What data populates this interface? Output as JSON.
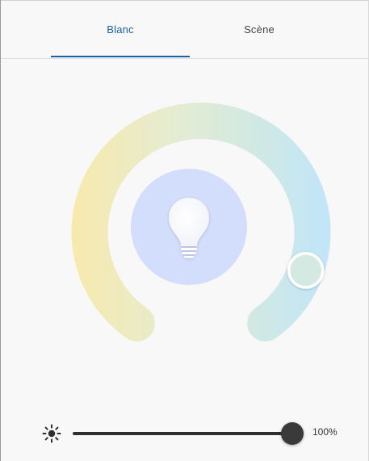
{
  "tabs": {
    "blanc": "Blanc",
    "scene": "Scène",
    "active": "blanc"
  },
  "colors": {
    "accent": "#1a5fa8",
    "warm_end": "#fbe9a8",
    "cool_end": "#c2e6f7",
    "center_disc": "#d3defc",
    "selector_fill": "#d3e9e1"
  },
  "color_temperature": {
    "selected_fraction": 0.88
  },
  "icons": {
    "center": "lightbulb-icon",
    "brightness": "sun-icon"
  },
  "brightness": {
    "value": 100,
    "label": "100%"
  }
}
